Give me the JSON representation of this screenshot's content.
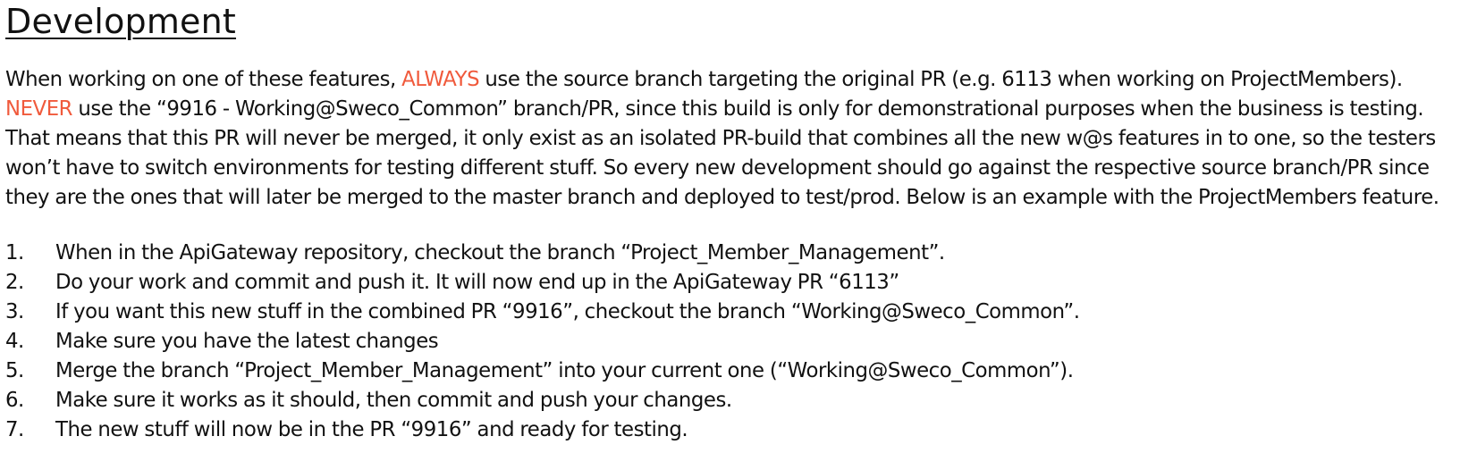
{
  "title": "Development",
  "accent_color": "#f05a3c",
  "intro": {
    "line1_pre": "When working on one of these features, ",
    "line1_accent": "ALWAYS",
    "line1_post": " use the source branch targeting the original PR (e.g. 6113 when working on ProjectMembers).",
    "line2_accent": "NEVER",
    "line2_post": " use the “9916 - Working@Sweco_Common” branch/PR, since this build is only for demonstrational purposes when the business is testing.",
    "line3": "That means that this PR will never be merged, it only exist as an isolated PR-build that combines all the new w@s features in to one, so the testers",
    "line4": "won’t have to switch environments for testing different stuff. So every new development should go against the respective source branch/PR since",
    "line5": "they are the ones that will later be merged to the master branch and deployed to test/prod. Below is an example with the ProjectMembers feature."
  },
  "steps": [
    {
      "num": "1.",
      "text": "When in the ApiGateway repository, checkout the branch “Project_Member_Management”."
    },
    {
      "num": "2.",
      "text": "Do your work and commit and push it. It will now end up in the ApiGateway PR “6113”"
    },
    {
      "num": "3.",
      "text": "If you want this new stuff in the combined PR “9916”, checkout the branch “Working@Sweco_Common”."
    },
    {
      "num": "4.",
      "text": "Make sure you have the latest changes"
    },
    {
      "num": "5.",
      "text": "Merge the branch “Project_Member_Management” into your current one (“Working@Sweco_Common”)."
    },
    {
      "num": "6.",
      "text": "Make sure it works as it should, then commit and push your changes."
    },
    {
      "num": "7.",
      "text": "The new stuff will now be in the PR “9916” and ready for testing."
    }
  ]
}
